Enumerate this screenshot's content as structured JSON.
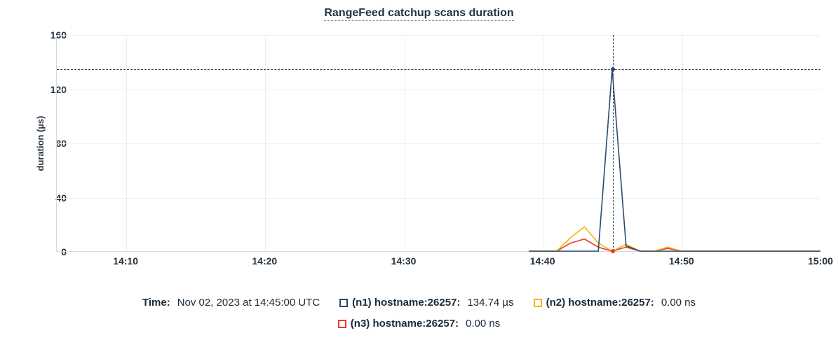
{
  "title": "RangeFeed catchup scans duration",
  "ylabel": "duration (µs)",
  "yticks": [
    "0",
    "40",
    "80",
    "120",
    "160"
  ],
  "xticks": [
    "14:10",
    "14:20",
    "14:30",
    "14:40",
    "14:50",
    "15:00"
  ],
  "legend": {
    "time_label": "Time:",
    "time_value": "Nov 02, 2023 at 14:45:00 UTC",
    "series": [
      {
        "swatch": "#2b4a6f",
        "name": "(n1) hostname:26257:",
        "value": "134.74 µs"
      },
      {
        "swatch": "#f0b800",
        "name": "(n2) hostname:26257:",
        "value": "0.00 ns"
      },
      {
        "swatch": "#e63a2e",
        "name": "(n3) hostname:26257:",
        "value": "0.00 ns"
      }
    ]
  },
  "chart_data": {
    "type": "line",
    "title": "RangeFeed catchup scans duration",
    "xlabel": "",
    "ylabel": "duration (µs)",
    "ylim": [
      0,
      160
    ],
    "x_range_minutes": [
      "14:05",
      "15:00"
    ],
    "x": [
      "14:39",
      "14:40",
      "14:41",
      "14:42",
      "14:43",
      "14:44",
      "14:45",
      "14:46",
      "14:47",
      "14:48",
      "14:49",
      "14:50",
      "14:55",
      "15:00"
    ],
    "series": [
      {
        "name": "(n1) hostname:26257",
        "color": "#2b4a6f",
        "values": [
          0,
          0,
          0,
          0,
          0,
          0,
          134.74,
          4,
          0,
          0,
          0,
          0,
          0,
          0
        ]
      },
      {
        "name": "(n2) hostname:26257",
        "color": "#f0b800",
        "values": [
          0,
          0,
          10,
          18,
          6,
          0,
          0,
          5,
          0,
          0,
          3,
          0,
          0,
          0
        ]
      },
      {
        "name": "(n3) hostname:26257",
        "color": "#e63a2e",
        "values": [
          0,
          0,
          6,
          9,
          3,
          0,
          0,
          3,
          0,
          0,
          2,
          0,
          0,
          0
        ]
      }
    ],
    "hover_x": "14:45",
    "hover_values": {
      "(n1) hostname:26257": "134.74 µs",
      "(n2) hostname:26257": "0.00 ns",
      "(n3) hostname:26257": "0.00 ns"
    }
  }
}
